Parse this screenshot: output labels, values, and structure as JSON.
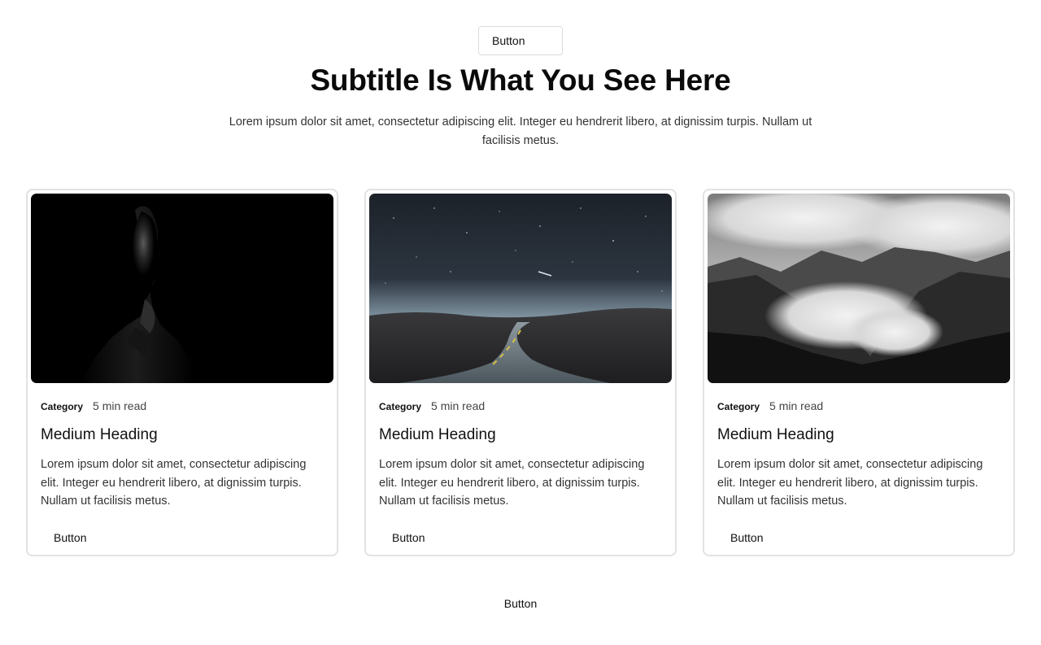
{
  "header": {
    "top_button_label": "Button",
    "title": "Subtitle Is What You See Here",
    "description": "Lorem ipsum dolor sit amet, consectetur adipiscing elit. Integer eu hendrerit libero, at dignissim turpis. Nullam ut facilisis metus."
  },
  "cards": [
    {
      "image_icon": "portrait-photo",
      "category": "Category",
      "read_time": "5 min read",
      "heading": "Medium Heading",
      "text": "Lorem ipsum dolor sit amet, consectetur adipiscing elit. Integer eu hendrerit libero, at dignissim turpis. Nullam ut facilisis metus.",
      "button_label": "Button"
    },
    {
      "image_icon": "night-road-photo",
      "category": "Category",
      "read_time": "5 min read",
      "heading": "Medium Heading",
      "text": "Lorem ipsum dolor sit amet, consectetur adipiscing elit. Integer eu hendrerit libero, at dignissim turpis. Nullam ut facilisis metus.",
      "button_label": "Button"
    },
    {
      "image_icon": "misty-mountains-photo",
      "category": "Category",
      "read_time": "5 min read",
      "heading": "Medium Heading",
      "text": "Lorem ipsum dolor sit amet, consectetur adipiscing elit. Integer eu hendrerit libero, at dignissim turpis. Nullam ut facilisis metus.",
      "button_label": "Button"
    }
  ],
  "footer": {
    "button_label": "Button"
  },
  "colors": {
    "background": "#ffffff",
    "text": "#111111",
    "border": "#e2e2e2"
  }
}
